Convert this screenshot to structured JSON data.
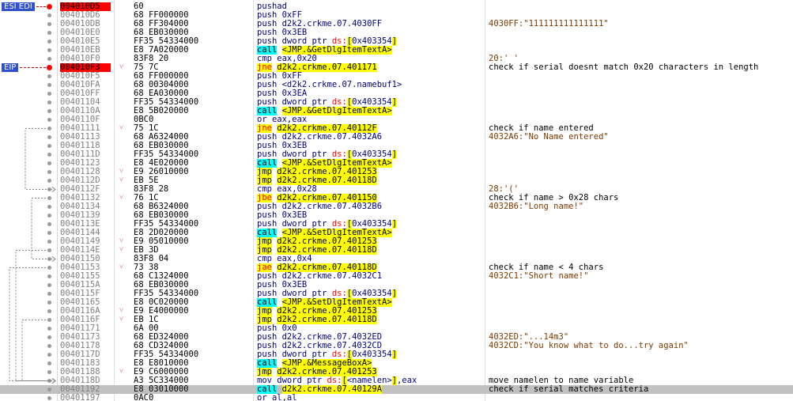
{
  "register_tags": [
    {
      "label": "ESI EDI",
      "row": 0
    },
    {
      "label": "EIP",
      "row": 7
    }
  ],
  "colors": {
    "current_ip_bg": "#ff0000",
    "selected_row_bg": "#c0c0c0",
    "jump_highlight": "#ffff00",
    "call_highlight": "#00ffff",
    "register_tag_bg": "#3050d0"
  },
  "rows": [
    {
      "addr": "004010D5",
      "bytes": "60",
      "jm": "",
      "dis": [
        [
          "t",
          "pushad"
        ]
      ],
      "cmt": "",
      "hl": true,
      "bp": true
    },
    {
      "addr": "004010D6",
      "bytes": "68 FF000000",
      "jm": "",
      "dis": [
        [
          "t",
          "push 0xFF"
        ]
      ],
      "cmt": ""
    },
    {
      "addr": "004010DB",
      "bytes": "68 FF304000",
      "jm": "",
      "dis": [
        [
          "t",
          "push d2k2.crkme.07.4030FF"
        ]
      ],
      "cmt": "4030FF:\"111111111111111\"",
      "cmtstr": true
    },
    {
      "addr": "004010E0",
      "bytes": "68 EB030000",
      "jm": "",
      "dis": [
        [
          "t",
          "push 0x3EB"
        ]
      ],
      "cmt": ""
    },
    {
      "addr": "004010E5",
      "bytes": "FF35 54334000",
      "jm": "",
      "dis": [
        [
          "t",
          "push dword ptr "
        ],
        [
          "seg",
          "ds:"
        ],
        [
          "br",
          "["
        ],
        [
          "t",
          "0x403354"
        ],
        [
          "br",
          "]"
        ]
      ],
      "cmt": ""
    },
    {
      "addr": "004010EB",
      "bytes": "E8 7A020000",
      "jm": "",
      "dis": [
        [
          "call",
          "call"
        ],
        [
          "t",
          " "
        ],
        [
          "sym",
          "<JMP.&GetDlgItemTextA>"
        ]
      ],
      "cmt": ""
    },
    {
      "addr": "004010F0",
      "bytes": "83F8 20",
      "jm": "",
      "dis": [
        [
          "t",
          "cmp eax,0x20"
        ]
      ],
      "cmt": "20:' '",
      "cmtstr": true
    },
    {
      "addr": "004010F3",
      "bytes": "75 7C",
      "jm": "v",
      "dis": [
        [
          "jcc",
          "jne"
        ],
        [
          "t",
          " "
        ],
        [
          "sym",
          "d2k2.crkme.07.401171"
        ]
      ],
      "cmt": "check if serial doesnt match 0x20 characters in length",
      "hl": true,
      "bp": true
    },
    {
      "addr": "004010F5",
      "bytes": "68 FF000000",
      "jm": "",
      "dis": [
        [
          "t",
          "push 0xFF"
        ]
      ],
      "cmt": ""
    },
    {
      "addr": "004010FA",
      "bytes": "68 00304000",
      "jm": "",
      "dis": [
        [
          "t",
          "push <d2k2.crkme.07.namebuf1>"
        ]
      ],
      "cmt": ""
    },
    {
      "addr": "004010FF",
      "bytes": "68 EA030000",
      "jm": "",
      "dis": [
        [
          "t",
          "push 0x3EA"
        ]
      ],
      "cmt": ""
    },
    {
      "addr": "00401104",
      "bytes": "FF35 54334000",
      "jm": "",
      "dis": [
        [
          "t",
          "push dword ptr "
        ],
        [
          "seg",
          "ds:"
        ],
        [
          "br",
          "["
        ],
        [
          "t",
          "0x403354"
        ],
        [
          "br",
          "]"
        ]
      ],
      "cmt": ""
    },
    {
      "addr": "0040110A",
      "bytes": "E8 5B020000",
      "jm": "",
      "dis": [
        [
          "call",
          "call"
        ],
        [
          "t",
          " "
        ],
        [
          "sym",
          "<JMP.&GetDlgItemTextA>"
        ]
      ],
      "cmt": ""
    },
    {
      "addr": "0040110F",
      "bytes": "0BC0",
      "jm": "",
      "dis": [
        [
          "t",
          "or eax,eax"
        ]
      ],
      "cmt": ""
    },
    {
      "addr": "00401111",
      "bytes": "75 1C",
      "jm": "v",
      "dis": [
        [
          "jcc",
          "jne"
        ],
        [
          "t",
          " "
        ],
        [
          "sym",
          "d2k2.crkme.07.40112F"
        ]
      ],
      "cmt": "check if name entered"
    },
    {
      "addr": "00401113",
      "bytes": "68 A6324000",
      "jm": "",
      "dis": [
        [
          "t",
          "push d2k2.crkme.07.4032A6"
        ]
      ],
      "cmt": "4032A6:\"No Name entered\"",
      "cmtstr": true
    },
    {
      "addr": "00401118",
      "bytes": "68 EB030000",
      "jm": "",
      "dis": [
        [
          "t",
          "push 0x3EB"
        ]
      ],
      "cmt": ""
    },
    {
      "addr": "0040111D",
      "bytes": "FF35 54334000",
      "jm": "",
      "dis": [
        [
          "t",
          "push dword ptr "
        ],
        [
          "seg",
          "ds:"
        ],
        [
          "br",
          "["
        ],
        [
          "t",
          "0x403354"
        ],
        [
          "br",
          "]"
        ]
      ],
      "cmt": ""
    },
    {
      "addr": "00401123",
      "bytes": "E8 4E020000",
      "jm": "",
      "dis": [
        [
          "call",
          "call"
        ],
        [
          "t",
          " "
        ],
        [
          "sym",
          "<JMP.&SetDlgItemTextA>"
        ]
      ],
      "cmt": ""
    },
    {
      "addr": "00401128",
      "bytes": "E9 26010000",
      "jm": "v",
      "dis": [
        [
          "jmp",
          "jmp"
        ],
        [
          "t",
          " "
        ],
        [
          "sym",
          "d2k2.crkme.07.401253"
        ]
      ],
      "cmt": ""
    },
    {
      "addr": "0040112D",
      "bytes": "EB 5E",
      "jm": "v",
      "dis": [
        [
          "jmp",
          "jmp"
        ],
        [
          "t",
          " "
        ],
        [
          "sym",
          "d2k2.crkme.07.40118D"
        ]
      ],
      "cmt": ""
    },
    {
      "addr": "0040112F",
      "bytes": "83F8 28",
      "jm": "",
      "dis": [
        [
          "t",
          "cmp eax,0x28"
        ]
      ],
      "cmt": "28:'('",
      "cmtstr": true
    },
    {
      "addr": "00401132",
      "bytes": "76 1C",
      "jm": "v",
      "dis": [
        [
          "jcc",
          "jbe"
        ],
        [
          "t",
          " "
        ],
        [
          "sym",
          "d2k2.crkme.07.401150"
        ]
      ],
      "cmt": "check if name > 0x28 chars"
    },
    {
      "addr": "00401134",
      "bytes": "68 B6324000",
      "jm": "",
      "dis": [
        [
          "t",
          "push d2k2.crkme.07.4032B6"
        ]
      ],
      "cmt": "4032B6:\"Long name!\"",
      "cmtstr": true
    },
    {
      "addr": "00401139",
      "bytes": "68 EB030000",
      "jm": "",
      "dis": [
        [
          "t",
          "push 0x3EB"
        ]
      ],
      "cmt": ""
    },
    {
      "addr": "0040113E",
      "bytes": "FF35 54334000",
      "jm": "",
      "dis": [
        [
          "t",
          "push dword ptr "
        ],
        [
          "seg",
          "ds:"
        ],
        [
          "br",
          "["
        ],
        [
          "t",
          "0x403354"
        ],
        [
          "br",
          "]"
        ]
      ],
      "cmt": ""
    },
    {
      "addr": "00401144",
      "bytes": "E8 2D020000",
      "jm": "",
      "dis": [
        [
          "call",
          "call"
        ],
        [
          "t",
          " "
        ],
        [
          "sym",
          "<JMP.&SetDlgItemTextA>"
        ]
      ],
      "cmt": ""
    },
    {
      "addr": "00401149",
      "bytes": "E9 05010000",
      "jm": "v",
      "dis": [
        [
          "jmp",
          "jmp"
        ],
        [
          "t",
          " "
        ],
        [
          "sym",
          "d2k2.crkme.07.401253"
        ]
      ],
      "cmt": ""
    },
    {
      "addr": "0040114E",
      "bytes": "EB 3D",
      "jm": "v",
      "dis": [
        [
          "jmp",
          "jmp"
        ],
        [
          "t",
          " "
        ],
        [
          "sym",
          "d2k2.crkme.07.40118D"
        ]
      ],
      "cmt": ""
    },
    {
      "addr": "00401150",
      "bytes": "83F8 04",
      "jm": "",
      "dis": [
        [
          "t",
          "cmp eax,0x4"
        ]
      ],
      "cmt": ""
    },
    {
      "addr": "00401153",
      "bytes": "73 38",
      "jm": "v",
      "dis": [
        [
          "jcc",
          "jae"
        ],
        [
          "t",
          " "
        ],
        [
          "sym",
          "d2k2.crkme.07.40118D"
        ]
      ],
      "cmt": "check if name < 4 chars"
    },
    {
      "addr": "00401155",
      "bytes": "68 C1324000",
      "jm": "",
      "dis": [
        [
          "t",
          "push d2k2.crkme.07.4032C1"
        ]
      ],
      "cmt": "4032C1:\"Short name!\"",
      "cmtstr": true
    },
    {
      "addr": "0040115A",
      "bytes": "68 EB030000",
      "jm": "",
      "dis": [
        [
          "t",
          "push 0x3EB"
        ]
      ],
      "cmt": ""
    },
    {
      "addr": "0040115F",
      "bytes": "FF35 54334000",
      "jm": "",
      "dis": [
        [
          "t",
          "push dword ptr "
        ],
        [
          "seg",
          "ds:"
        ],
        [
          "br",
          "["
        ],
        [
          "t",
          "0x403354"
        ],
        [
          "br",
          "]"
        ]
      ],
      "cmt": ""
    },
    {
      "addr": "00401165",
      "bytes": "E8 0C020000",
      "jm": "",
      "dis": [
        [
          "call",
          "call"
        ],
        [
          "t",
          " "
        ],
        [
          "sym",
          "<JMP.&SetDlgItemTextA>"
        ]
      ],
      "cmt": ""
    },
    {
      "addr": "0040116A",
      "bytes": "E9 E4000000",
      "jm": "v",
      "dis": [
        [
          "jmp",
          "jmp"
        ],
        [
          "t",
          " "
        ],
        [
          "sym",
          "d2k2.crkme.07.401253"
        ]
      ],
      "cmt": ""
    },
    {
      "addr": "0040116F",
      "bytes": "EB 1C",
      "jm": "v",
      "dis": [
        [
          "jmp",
          "jmp"
        ],
        [
          "t",
          " "
        ],
        [
          "sym",
          "d2k2.crkme.07.40118D"
        ]
      ],
      "cmt": ""
    },
    {
      "addr": "00401171",
      "bytes": "6A 00",
      "jm": "",
      "dis": [
        [
          "t",
          "push 0x0"
        ]
      ],
      "cmt": ""
    },
    {
      "addr": "00401173",
      "bytes": "68 ED324000",
      "jm": "",
      "dis": [
        [
          "t",
          "push d2k2.crkme.07.4032ED"
        ]
      ],
      "cmt": "4032ED:\"...14m3\"",
      "cmtstr": true
    },
    {
      "addr": "00401178",
      "bytes": "68 CD324000",
      "jm": "",
      "dis": [
        [
          "t",
          "push d2k2.crkme.07.4032CD"
        ]
      ],
      "cmt": "4032CD:\"You know what to do...try again\"",
      "cmtstr": true
    },
    {
      "addr": "0040117D",
      "bytes": "FF35 54334000",
      "jm": "",
      "dis": [
        [
          "t",
          "push dword ptr "
        ],
        [
          "seg",
          "ds:"
        ],
        [
          "br",
          "["
        ],
        [
          "t",
          "0x403354"
        ],
        [
          "br",
          "]"
        ]
      ],
      "cmt": ""
    },
    {
      "addr": "00401183",
      "bytes": "E8 E8010000",
      "jm": "",
      "dis": [
        [
          "call",
          "call"
        ],
        [
          "t",
          " "
        ],
        [
          "sym",
          "<JMP.&MessageBoxA>"
        ]
      ],
      "cmt": ""
    },
    {
      "addr": "00401188",
      "bytes": "E9 C6000000",
      "jm": "v",
      "dis": [
        [
          "jmp",
          "jmp"
        ],
        [
          "t",
          " "
        ],
        [
          "sym",
          "d2k2.crkme.07.401253"
        ]
      ],
      "cmt": ""
    },
    {
      "addr": "0040118D",
      "bytes": "A3 5C334000",
      "jm": "",
      "dis": [
        [
          "t",
          "mov dword ptr "
        ],
        [
          "seg",
          "ds:"
        ],
        [
          "br",
          "["
        ],
        [
          "t",
          "<namelen>"
        ],
        [
          "br",
          "]"
        ],
        [
          "t",
          ",eax"
        ]
      ],
      "cmt": "move namelen to name variable"
    },
    {
      "addr": "00401192",
      "bytes": "E8 03010000",
      "jm": "",
      "dis": [
        [
          "call",
          "call"
        ],
        [
          "t",
          " "
        ],
        [
          "sym",
          "d2k2.crkme.07.40129A"
        ]
      ],
      "cmt": "check if serial matches criteria",
      "current": true
    },
    {
      "addr": "00401197",
      "bytes": "0AC0",
      "jm": "",
      "dis": [
        [
          "t",
          "or al,al"
        ]
      ],
      "cmt": ""
    }
  ]
}
